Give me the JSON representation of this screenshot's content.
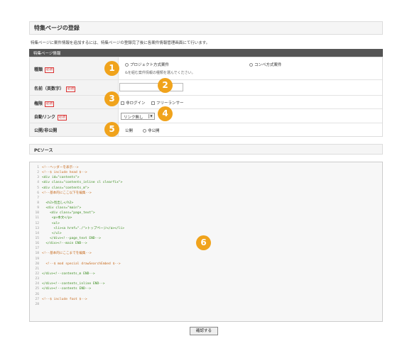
{
  "page": {
    "title": "特集ページの登録",
    "description": "特集ページに案件情報を追加するには、特集ページの登録完了後に各案件情報管理画面にて行います。"
  },
  "section": {
    "header": "特集ページ情報"
  },
  "required_label": "必須",
  "form": {
    "type": {
      "label": "種類",
      "options": [
        "プロジェクト方式案件",
        "コンペ方式案件"
      ],
      "hint": "&を組む案件情報の種類を選んでください。"
    },
    "name": {
      "label": "名前（英数字）",
      "value": ""
    },
    "permission": {
      "label": "権限",
      "options": [
        "非ログイン",
        "フリーランサー"
      ]
    },
    "auto_link": {
      "label": "自動リンク",
      "selected": "リンク無し"
    },
    "visibility": {
      "label": "公開/非公開",
      "options": [
        "公開",
        "非公開"
      ]
    }
  },
  "pc_source": {
    "label": "PCソース"
  },
  "code": [
    {
      "n": "1",
      "t": "<!--ヘッダーを表示-->",
      "c": "comment"
    },
    {
      "n": "2",
      "t": "<!--$ include head $-->",
      "c": "comment"
    },
    {
      "n": "3",
      "t": "<div id=\"contents\">",
      "c": "tag"
    },
    {
      "n": "4",
      "t": "<div class=\"contents_inline cl clearfix\">",
      "c": "tag"
    },
    {
      "n": "5",
      "t": "<div class=\"contents_m\">",
      "c": "tag"
    },
    {
      "n": "6",
      "t": "<!--基本的にここ以下を編集-->",
      "c": "comment"
    },
    {
      "n": "7",
      "t": "",
      "c": "text"
    },
    {
      "n": "8",
      "t": "  <h2>見出し</h2>",
      "c": "tag"
    },
    {
      "n": "9",
      "t": "  <div class=\"main\">",
      "c": "tag"
    },
    {
      "n": "10",
      "t": "    <div class=\"page_text\">",
      "c": "tag"
    },
    {
      "n": "11",
      "t": "     <p>本文</p>",
      "c": "tag"
    },
    {
      "n": "12",
      "t": "     <ul>",
      "c": "tag"
    },
    {
      "n": "13",
      "t": "      <li><a href=\"./\">トップページ</a></li>",
      "c": "tag"
    },
    {
      "n": "14",
      "t": "     </ul>",
      "c": "tag"
    },
    {
      "n": "15",
      "t": "    </div><!--page_text END-->",
      "c": "tag"
    },
    {
      "n": "16",
      "t": "  </div><!--main END-->",
      "c": "tag"
    },
    {
      "n": "17",
      "t": "",
      "c": "text"
    },
    {
      "n": "18",
      "t": "<!--基本的にここまでを編集-->",
      "c": "comment"
    },
    {
      "n": "19",
      "t": "",
      "c": "text"
    },
    {
      "n": "20",
      "t": "  <!--$ mod special drawSearchEmbed $-->",
      "c": "comment"
    },
    {
      "n": "21",
      "t": "",
      "c": "text"
    },
    {
      "n": "22",
      "t": "</div><!--contents_m END-->",
      "c": "tag"
    },
    {
      "n": "23",
      "t": "",
      "c": "text"
    },
    {
      "n": "24",
      "t": "</div><!--contents_inline END-->",
      "c": "tag"
    },
    {
      "n": "25",
      "t": "</div><!--contents END-->",
      "c": "tag"
    },
    {
      "n": "26",
      "t": "",
      "c": "text"
    },
    {
      "n": "27",
      "t": "<!--$ include foot $-->",
      "c": "comment"
    },
    {
      "n": "28",
      "t": "",
      "c": "text"
    }
  ],
  "confirm_button": "確認する",
  "badges": [
    "1",
    "2",
    "3",
    "4",
    "5",
    "6"
  ],
  "colors": {
    "badge": "#f0a31c",
    "section_header": "#555555",
    "required": "#dd3333"
  }
}
